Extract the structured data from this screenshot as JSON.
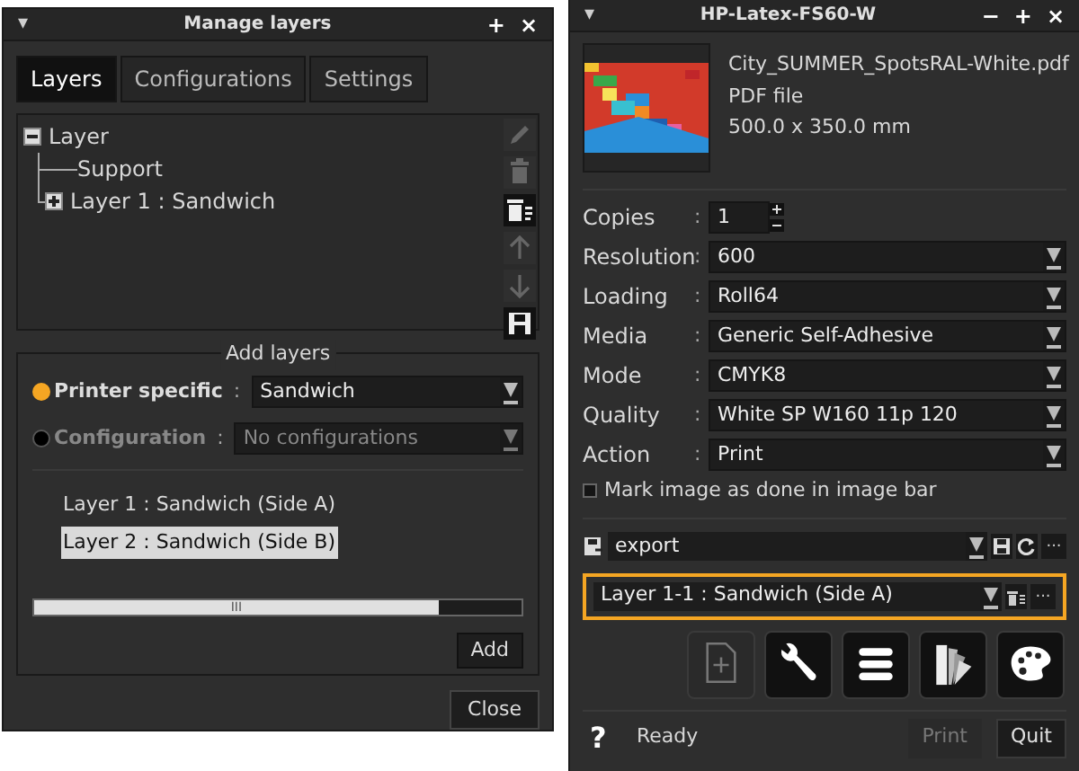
{
  "manage_layers": {
    "title": "Manage layers",
    "menu_glyph": "▾",
    "controls": [
      "+",
      "×"
    ],
    "tabs": [
      {
        "label": "Layers",
        "selected": true
      },
      {
        "label": "Configurations",
        "selected": false
      },
      {
        "label": "Settings",
        "selected": false
      }
    ],
    "tree": [
      {
        "label": "Layer",
        "expanded": true,
        "children": [
          {
            "label": "Support"
          },
          {
            "label": "Layer 1 : Sandwich",
            "expanded": false
          }
        ]
      }
    ],
    "tools": [
      {
        "kind": "edit",
        "disabled": true
      },
      {
        "kind": "delete",
        "disabled": true
      },
      {
        "kind": "delete-all",
        "disabled": false
      },
      {
        "kind": "up",
        "disabled": true
      },
      {
        "kind": "down",
        "disabled": true
      },
      {
        "kind": "save",
        "disabled": false
      }
    ],
    "add_layers": {
      "title": "Add layers",
      "sources": [
        {
          "label": "Printer specific",
          "sep": ":",
          "value": "Sandwich",
          "selected": true,
          "disabled": false
        },
        {
          "label": "Configuration",
          "sep": ":",
          "value": "No configurations",
          "selected": false,
          "disabled": true
        }
      ],
      "layers": [
        {
          "label": "Layer 1 : Sandwich (Side A)",
          "selected": false
        },
        {
          "label": "Layer 2 : Sandwich (Side B)",
          "selected": true
        }
      ],
      "scroll_grip": "III",
      "add_button": "Add"
    },
    "close_button": "Close"
  },
  "printer": {
    "title": "HP-Latex-FS60-W",
    "menu_glyph": "▾",
    "controls": [
      "−",
      "+",
      "×"
    ],
    "file": {
      "name": "City_SUMMER_SpotsRAL-White.pdf",
      "type": "PDF file",
      "size": "500.0 x 350.0 mm"
    },
    "settings": [
      {
        "label": "Copies",
        "sep": ":",
        "value": "1",
        "kind": "spinner"
      },
      {
        "label": "Resolution",
        "sep": ":",
        "value": "600",
        "kind": "select"
      },
      {
        "label": "Loading",
        "sep": ":",
        "value": "Roll64",
        "kind": "select"
      },
      {
        "label": "Media",
        "sep": ":",
        "value": "Generic Self-Adhesive",
        "kind": "select"
      },
      {
        "label": "Mode",
        "sep": ":",
        "value": "CMYK8",
        "kind": "select"
      },
      {
        "label": "Quality",
        "sep": ":",
        "value": "White SP W160 11p 120",
        "kind": "select"
      },
      {
        "label": "Action",
        "sep": ":",
        "value": "Print",
        "kind": "select"
      }
    ],
    "mark_done": {
      "label": "Mark image as done in image bar",
      "checked": false
    },
    "export": {
      "value": "export",
      "more": "..."
    },
    "layer": {
      "value": "Layer 1-1 : Sandwich (Side A)",
      "highlighted": true,
      "more": "..."
    },
    "actions": [
      {
        "kind": "layout",
        "disabled": true
      },
      {
        "kind": "wrench",
        "disabled": false
      },
      {
        "kind": "list",
        "disabled": false
      },
      {
        "kind": "swatch",
        "disabled": false
      },
      {
        "kind": "palette",
        "disabled": false
      }
    ],
    "help": "?",
    "status": "Ready",
    "buttons": [
      {
        "label": "Print",
        "disabled": true
      },
      {
        "label": "Quit",
        "disabled": false
      }
    ]
  }
}
